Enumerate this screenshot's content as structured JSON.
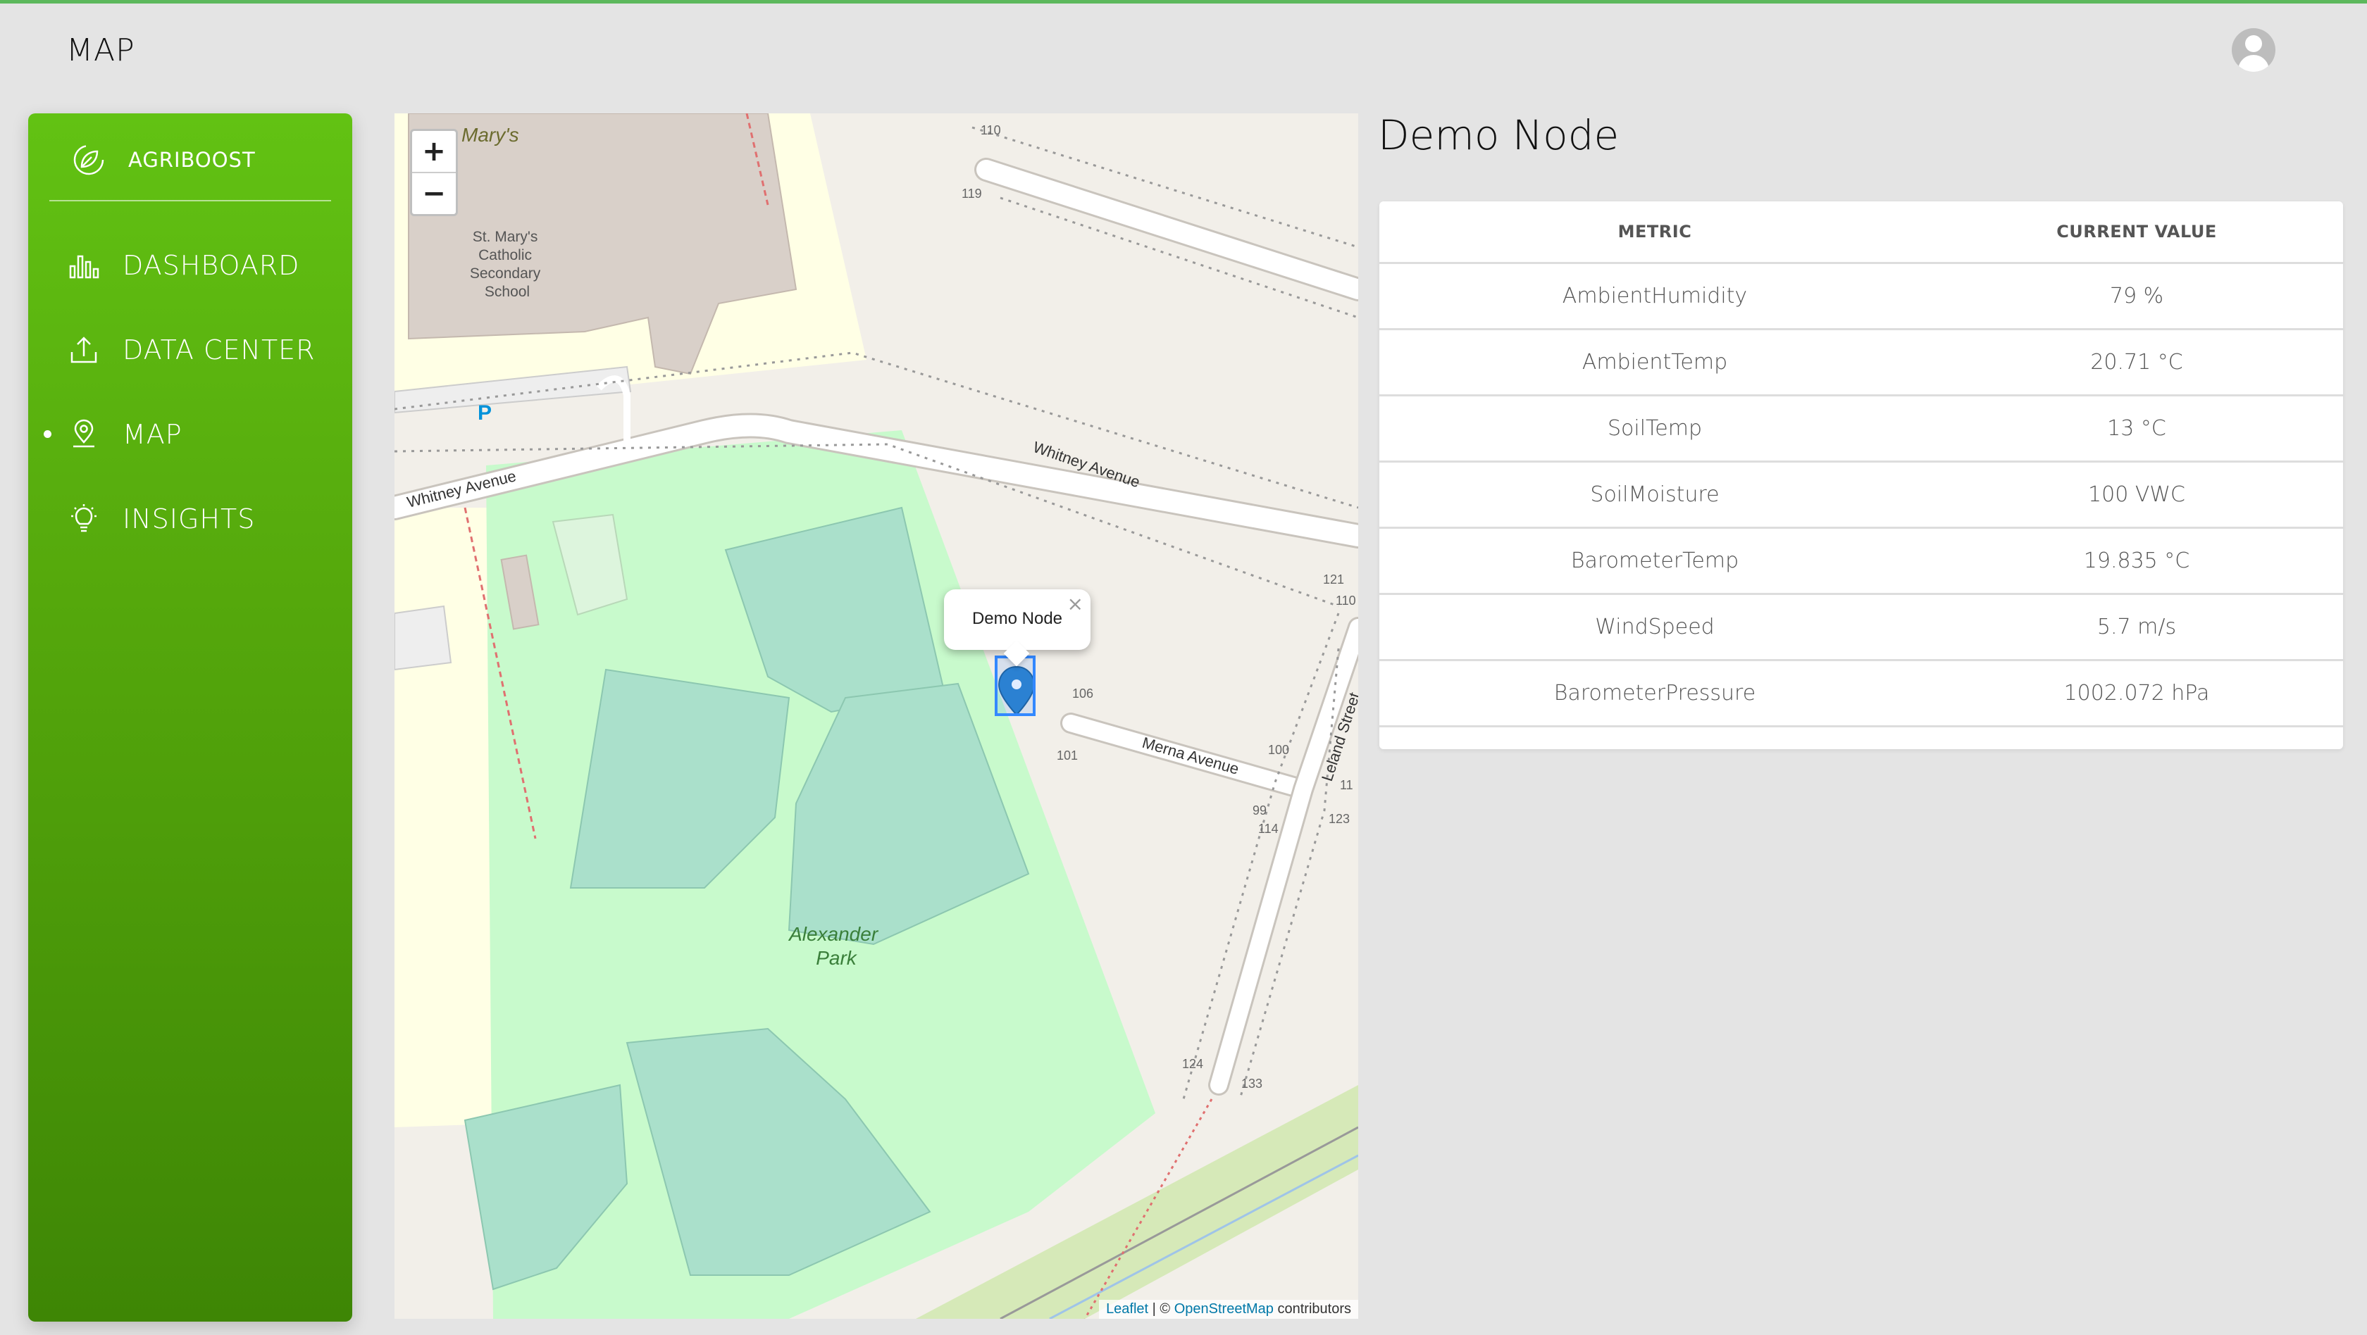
{
  "header": {
    "title": "MAP"
  },
  "sidebar": {
    "brand": "AGRIBOOST",
    "items": [
      {
        "label": "DASHBOARD",
        "icon": "bar-chart-icon",
        "active": false
      },
      {
        "label": "DATA CENTER",
        "icon": "upload-icon",
        "active": false
      },
      {
        "label": "MAP",
        "icon": "map-pin-icon",
        "active": true
      },
      {
        "label": "INSIGHTS",
        "icon": "lightbulb-icon",
        "active": false
      }
    ]
  },
  "map": {
    "zoom_in": "+",
    "zoom_out": "−",
    "popup": {
      "title": "Demo Node",
      "close": "×"
    },
    "labels": {
      "school": [
        "St. Mary's",
        "Catholic",
        "Secondary",
        "School"
      ],
      "marys": "Mary's",
      "street1": "Whitney Avenue",
      "street1b": "Whitney Avenue",
      "street2": "Merna Avenue",
      "street3": "Leland Street",
      "park_line1": "Alexander",
      "park_line2": "Park",
      "parking": "P",
      "house_numbers": [
        "110",
        "119",
        "121",
        "110",
        "106",
        "100",
        "101",
        "99",
        "114",
        "123",
        "124",
        "133",
        "11"
      ]
    },
    "attribution": {
      "leaflet": "Leaflet",
      "separator": " | © ",
      "osm": "OpenStreetMap",
      "suffix": " contributors"
    }
  },
  "details": {
    "title": "Demo Node",
    "table": {
      "headers": [
        "METRIC",
        "CURRENT VALUE"
      ],
      "rows": [
        {
          "metric": "AmbientHumidity",
          "value": "79 %"
        },
        {
          "metric": "AmbientTemp",
          "value": "20.71 °C"
        },
        {
          "metric": "SoilTemp",
          "value": "13 °C"
        },
        {
          "metric": "SoilMoisture",
          "value": "100 VWC"
        },
        {
          "metric": "BarometerTemp",
          "value": "19.835 °C"
        },
        {
          "metric": "WindSpeed",
          "value": "5.7 m/s"
        },
        {
          "metric": "BarometerPressure",
          "value": "1002.072 hPa"
        }
      ]
    }
  },
  "colors": {
    "accent": "#5cb85c",
    "sidebar_top": "#62c213",
    "sidebar_bottom": "#3e8605",
    "marker": "#2a81cb"
  }
}
